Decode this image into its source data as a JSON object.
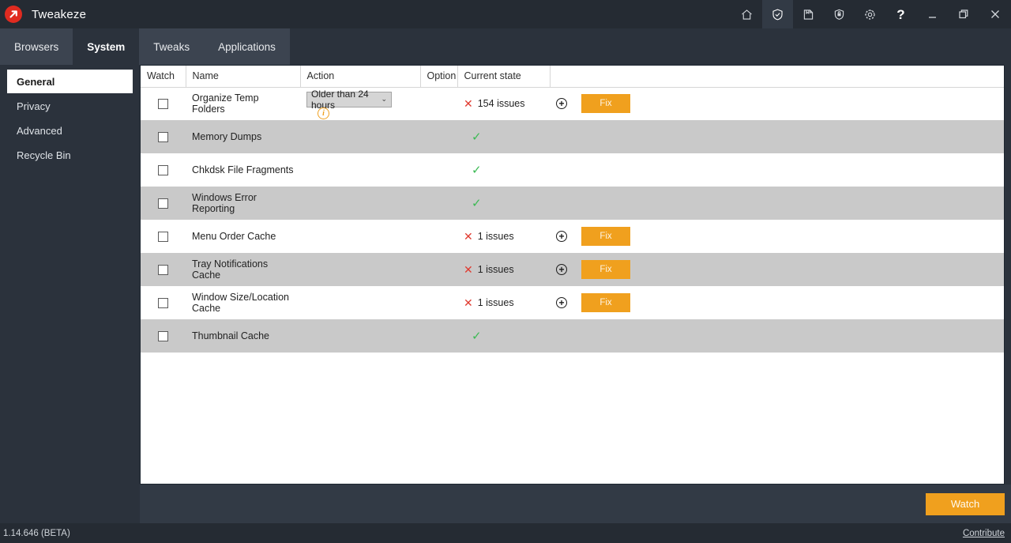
{
  "window": {
    "title": "Tweakeze",
    "logo_icon": "red-arrow-logo",
    "controls": [
      {
        "name": "home-icon",
        "label": "Home",
        "active": false
      },
      {
        "name": "shield-check-icon",
        "label": "Cleaner",
        "active": true
      },
      {
        "name": "document-icon",
        "label": "Reports",
        "active": false
      },
      {
        "name": "shield-lock-icon",
        "label": "Security",
        "active": false
      },
      {
        "name": "gear-icon",
        "label": "Settings",
        "active": false
      },
      {
        "name": "help-icon",
        "label": "?",
        "active": false
      },
      {
        "name": "minimize-icon",
        "label": "Minimize",
        "active": false
      },
      {
        "name": "maximize-icon",
        "label": "Maximize",
        "active": false
      },
      {
        "name": "close-icon",
        "label": "Close",
        "active": false
      }
    ]
  },
  "tabs": [
    {
      "label": "Browsers",
      "active": false
    },
    {
      "label": "System",
      "active": true
    },
    {
      "label": "Tweaks",
      "active": false
    },
    {
      "label": "Applications",
      "active": false
    }
  ],
  "sidebar": {
    "items": [
      {
        "label": "General",
        "active": true
      },
      {
        "label": "Privacy",
        "active": false
      },
      {
        "label": "Advanced",
        "active": false
      },
      {
        "label": "Recycle Bin",
        "active": false
      }
    ]
  },
  "table": {
    "columns": [
      "Watch",
      "Name",
      "Action",
      "Option",
      "Current state",
      ""
    ],
    "rows": [
      {
        "name": "Organize Temp Folders",
        "checked": false,
        "action": {
          "type": "dropdown",
          "value": "Older than 24 hours"
        },
        "info_icon": true,
        "option": "",
        "state": {
          "type": "issues",
          "text": "154 issues"
        },
        "detail_icon": true,
        "fix_label": "Fix",
        "shaded": false
      },
      {
        "name": "Memory Dumps",
        "checked": false,
        "action": null,
        "info_icon": false,
        "option": "",
        "state": {
          "type": "ok",
          "text": ""
        },
        "detail_icon": false,
        "fix_label": "",
        "shaded": true
      },
      {
        "name": "Chkdsk File Fragments",
        "checked": false,
        "action": null,
        "info_icon": false,
        "option": "",
        "state": {
          "type": "ok",
          "text": ""
        },
        "detail_icon": false,
        "fix_label": "",
        "shaded": false
      },
      {
        "name": "Windows Error Reporting",
        "checked": false,
        "action": null,
        "info_icon": false,
        "option": "",
        "state": {
          "type": "ok",
          "text": ""
        },
        "detail_icon": false,
        "fix_label": "",
        "shaded": true
      },
      {
        "name": "Menu Order Cache",
        "checked": false,
        "action": null,
        "info_icon": false,
        "option": "",
        "state": {
          "type": "issues",
          "text": "1 issues"
        },
        "detail_icon": true,
        "fix_label": "Fix",
        "shaded": false
      },
      {
        "name": "Tray Notifications Cache",
        "checked": false,
        "action": null,
        "info_icon": false,
        "option": "",
        "state": {
          "type": "issues",
          "text": "1 issues"
        },
        "detail_icon": true,
        "fix_label": "Fix",
        "shaded": true
      },
      {
        "name": "Window Size/Location Cache",
        "checked": false,
        "action": null,
        "info_icon": false,
        "option": "",
        "state": {
          "type": "issues",
          "text": "1 issues"
        },
        "detail_icon": true,
        "fix_label": "Fix",
        "shaded": false
      },
      {
        "name": "Thumbnail Cache",
        "checked": false,
        "action": null,
        "info_icon": false,
        "option": "",
        "state": {
          "type": "ok",
          "text": ""
        },
        "detail_icon": false,
        "fix_label": "",
        "shaded": true
      }
    ]
  },
  "footer": {
    "watch_label": "Watch"
  },
  "statusbar": {
    "version": "1.14.646 (BETA)",
    "contribute": "Contribute"
  },
  "colors": {
    "titlebar": "#252b33",
    "chrome": "#2b323c",
    "tab_inactive": "#3c4450",
    "accent_orange": "#f0a01e",
    "logo_red": "#e02b20",
    "ok_green": "#3cba54",
    "error_red": "#e03a2f",
    "row_alt": "#c9c9c9"
  }
}
